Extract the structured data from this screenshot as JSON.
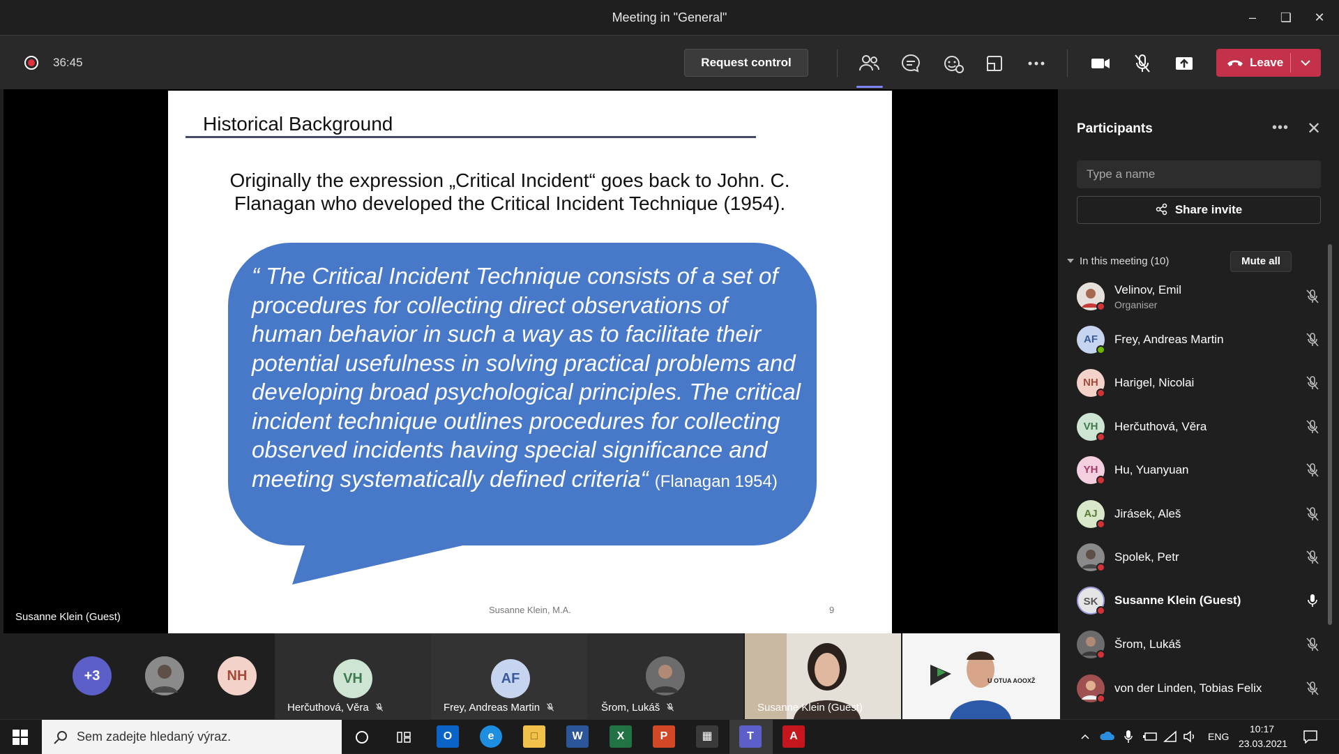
{
  "window": {
    "title": "Meeting in \"General\""
  },
  "toolbar": {
    "timer": "36:45",
    "request_control": "Request control",
    "leave_label": "Leave",
    "icons": [
      "people-icon",
      "chat-icon",
      "reactions-icon",
      "room-icon",
      "more-icon",
      "camera-icon",
      "mic-muted-icon",
      "share-tray-icon"
    ]
  },
  "slide": {
    "title": "Historical Background",
    "intro": "Originally the expression „Critical Incident“ goes back to John. C. Flanagan who developed the Critical Incident Technique (1954).",
    "quote": "“ The Critical Incident Technique consists of a set of procedures for collecting direct observations of human behavior in such a way as to facilitate their potential usefulness in solving practical problems and developing broad psychological principles. The critical incident technique outlines procedures for collecting observed incidents having special significance and meeting systematically defined criteria“",
    "citation": "(Flanagan 1954)",
    "footer": "Susanne Klein, M.A.",
    "page": "9"
  },
  "presenter": {
    "name": "Susanne Klein (Guest)"
  },
  "panel": {
    "title": "Participants",
    "search_placeholder": "Type a name",
    "share_invite": "Share invite",
    "section_label": "In this meeting (10)",
    "mute_all": "Mute all",
    "participants": [
      {
        "name": "Velinov, Emil",
        "role": "Organiser",
        "initials": "",
        "mic": "muted"
      },
      {
        "name": "Frey, Andreas Martin",
        "role": "",
        "initials": "AF",
        "mic": "muted"
      },
      {
        "name": "Harigel, Nicolai",
        "role": "",
        "initials": "NH",
        "mic": "muted"
      },
      {
        "name": "Herčuthová, Věra",
        "role": "",
        "initials": "VH",
        "mic": "muted"
      },
      {
        "name": "Hu, Yuanyuan",
        "role": "",
        "initials": "YH",
        "mic": "muted"
      },
      {
        "name": "Jirásek, Aleš",
        "role": "",
        "initials": "AJ",
        "mic": "muted"
      },
      {
        "name": "Spolek, Petr",
        "role": "",
        "initials": "",
        "mic": "muted"
      },
      {
        "name": "Susanne Klein (Guest)",
        "role": "",
        "initials": "SK",
        "mic": "on"
      },
      {
        "name": "Šrom, Lukáš",
        "role": "",
        "initials": "",
        "mic": "muted"
      },
      {
        "name": "von der Linden, Tobias Felix",
        "role": "",
        "initials": "",
        "mic": "muted"
      }
    ]
  },
  "strip": {
    "overflow": "+3",
    "nh": "NH",
    "tiles": [
      {
        "initials": "VH",
        "name": "Herčuthová, Věra"
      },
      {
        "initials": "AF",
        "name": "Frey, Andreas Martin"
      },
      {
        "initials": "",
        "name": "Šrom, Lukáš"
      },
      {
        "initials": "",
        "name": "Susanne Klein (Guest)"
      }
    ],
    "video_caption": "U OTUA AOOXŽ"
  },
  "taskbar": {
    "search_text": "Sem zadejte hledaný výraz.",
    "lang": "ENG",
    "time": "10:17",
    "date": "23.03.2021"
  },
  "colors": {
    "leave": "#c4314b",
    "accent": "#7f85f5",
    "bubble": "#4878c8"
  }
}
